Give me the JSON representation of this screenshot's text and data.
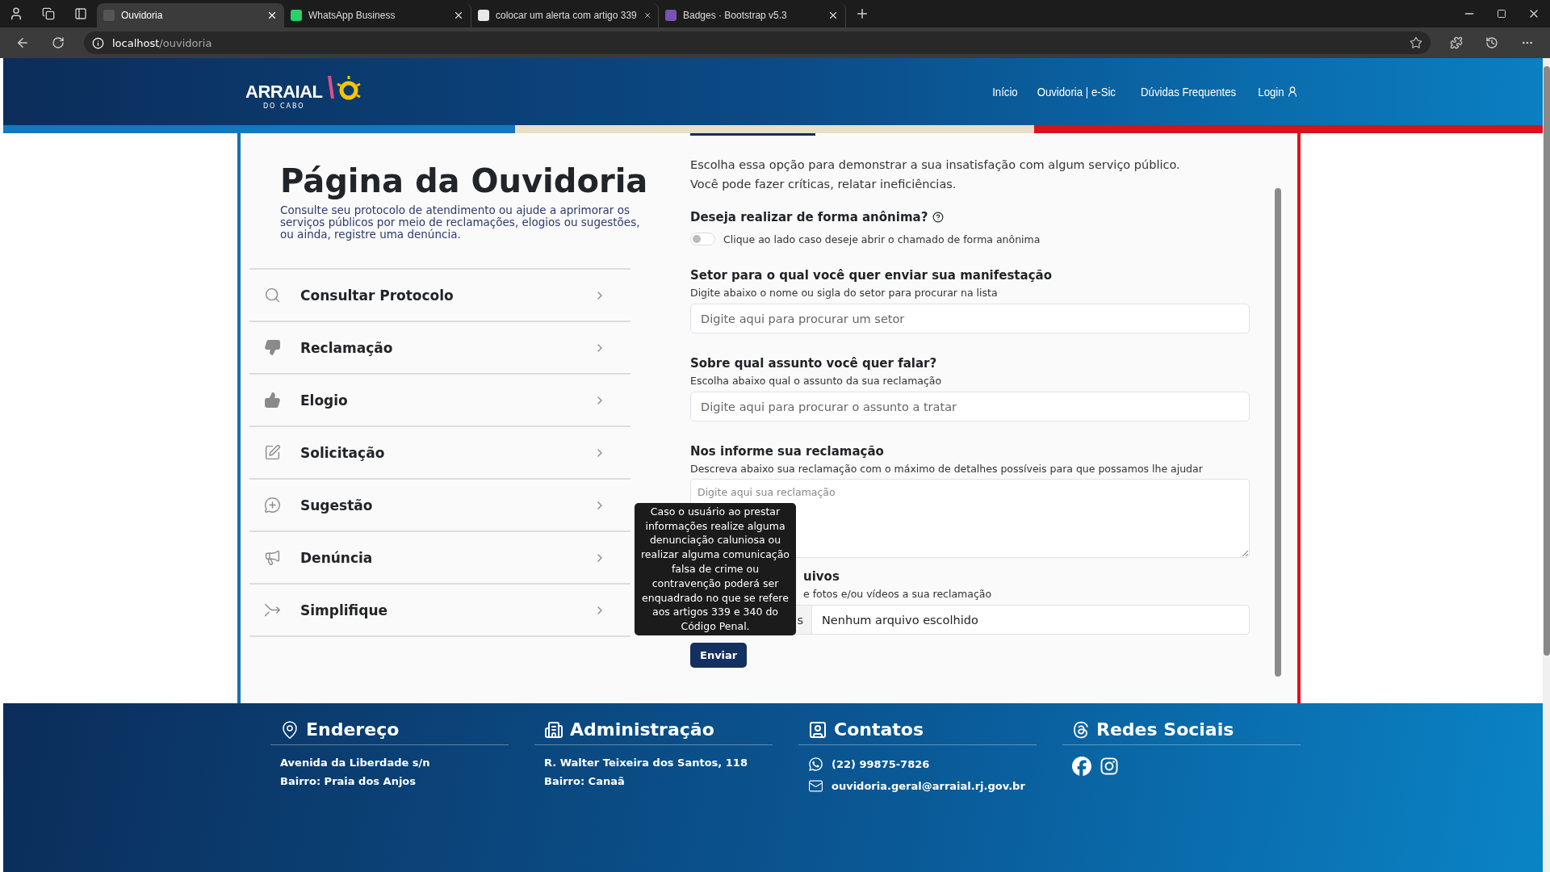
{
  "browser": {
    "tabs": [
      {
        "title": "Ouvidoria",
        "selected": true
      },
      {
        "title": "WhatsApp Business",
        "selected": false
      },
      {
        "title": "colocar um alerta com artigo 339",
        "selected": false
      },
      {
        "title": "Badges · Bootstrap v5.3",
        "selected": false
      }
    ],
    "url_host": "localhost",
    "url_path": "/ouvidoria"
  },
  "header": {
    "logo": {
      "name": "ARRAIAL",
      "sub": "DO CABO"
    },
    "nav": [
      {
        "label": "Início",
        "kind": "link"
      },
      {
        "label": "Ouvidoria | e-Sic",
        "kind": "link"
      },
      {
        "label": "Dúvidas Frequentes",
        "kind": "link"
      },
      {
        "label": "Login",
        "kind": "login"
      }
    ]
  },
  "intro": {
    "title": "Página da Ouvidoria",
    "description": "Consulte seu protocolo de atendimento ou ajude a aprimorar os serviços públicos por meio de reclamações, elogios ou sugestões, ou ainda, registre uma denúncia."
  },
  "menu": [
    {
      "kind": "search",
      "label": "Consultar Protocolo"
    },
    {
      "kind": "complaint",
      "label": "Reclamação"
    },
    {
      "kind": "praise",
      "label": "Elogio"
    },
    {
      "kind": "request",
      "label": "Solicitação"
    },
    {
      "kind": "suggestion",
      "label": "Sugestão"
    },
    {
      "kind": "report",
      "label": "Denúncia"
    },
    {
      "kind": "simplify",
      "label": "Simplifique"
    }
  ],
  "form": {
    "description": [
      "Escolha essa opção para demonstrar a sua insatisfação com algum serviço público.",
      "Você pode fazer críticas, relatar ineficiências."
    ],
    "anonymous": {
      "question": "Deseja realizar de forma anônima?",
      "on": false,
      "hint": "Clique ao lado caso deseje abrir o chamado de forma anônima"
    },
    "fields": [
      {
        "kind": "input",
        "label": "Setor para o qual você quer enviar sua manifestação",
        "hint": "Digite abaixo o nome ou sigla do setor para procurar na lista",
        "placeholder": "Digite aqui para procurar um setor"
      },
      {
        "kind": "input",
        "label": "Sobre qual assunto você quer falar?",
        "hint": "Escolha abaixo qual o assunto da sua reclamação",
        "placeholder": "Digite aqui para procurar o assunto a tratar"
      },
      {
        "kind": "textarea",
        "label": "Nos informe sua reclamação",
        "hint": "Descreva abaixo sua reclamação com o máximo de detalhes possíveis para que possamos lhe ajudar",
        "placeholder": "Digite aqui sua reclamação"
      }
    ],
    "attachments": {
      "label": "uivos",
      "hint": "e fotos e/ou vídeos a sua reclamação",
      "button": "s",
      "file_status": "Nenhum arquivo escolhido"
    },
    "submit": "Enviar",
    "tooltip": "Caso o usuário ao prestar informações realize alguma denunciação caluniosa ou realizar alguma comunicação falsa de crime ou contravenção poderá ser enquadrado no que se refere aos artigos 339 e 340 do Código Penal."
  },
  "footer": {
    "columns": [
      {
        "kind": "address",
        "title": "Endereço",
        "lines": [
          "Avenida da Liberdade s/n",
          "Bairro: Praia dos Anjos"
        ]
      },
      {
        "kind": "admin",
        "title": "Administração",
        "lines": [
          "R. Walter Teixeira dos Santos, 118",
          "Bairro: Canaã"
        ]
      },
      {
        "kind": "contacts",
        "title": "Contatos",
        "items": [
          {
            "kind": "whatsapp",
            "text": "(22) 99875-7826"
          },
          {
            "kind": "email",
            "text": "ouvidoria.geral@arraial.rj.gov.br"
          }
        ]
      },
      {
        "kind": "social",
        "title": "Redes Sociais",
        "links": [
          {
            "kind": "facebook"
          },
          {
            "kind": "instagram"
          }
        ]
      }
    ]
  }
}
